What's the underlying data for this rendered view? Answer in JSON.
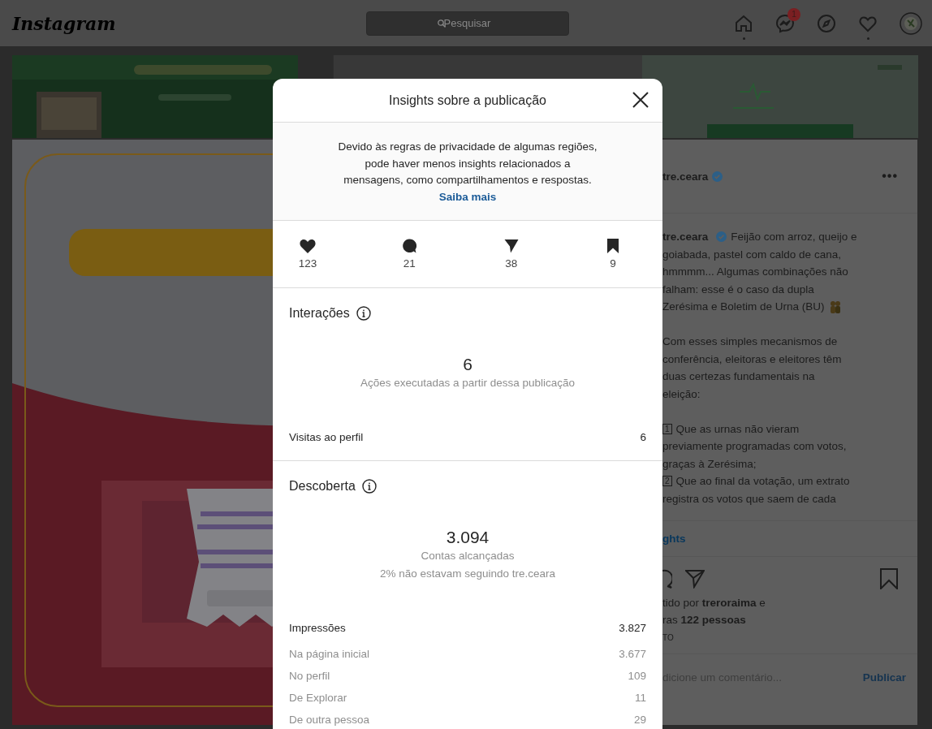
{
  "nav": {
    "logo": "Instagram",
    "search": {
      "placeholder": "Pesquisar"
    },
    "items": [
      {
        "kind": "home",
        "dot": true
      },
      {
        "kind": "messages",
        "badge": "1",
        "dot": false
      },
      {
        "kind": "explore",
        "dot": false
      },
      {
        "kind": "activity",
        "dot": true
      },
      {
        "kind": "profile",
        "dot": false
      }
    ]
  },
  "post": {
    "username": "tre.ceara",
    "verified": true,
    "more": "•••",
    "caption": [
      {
        "kind": "author",
        "user": "tre.ceara",
        "verified": true,
        "text": "Feijão com arroz, queijo e"
      },
      {
        "kind": "text",
        "text": "goiabada, pastel com caldo de cana,"
      },
      {
        "kind": "text",
        "text": "hmmmm... Algumas combinações não"
      },
      {
        "kind": "text",
        "text": "falham: esse é o caso da dupla"
      },
      {
        "kind": "emoji",
        "text": "Zerésima e Boletim de Urna (BU)"
      },
      {
        "kind": "text",
        "text": "Com esses simples mecanismos de",
        "space_before": true
      },
      {
        "kind": "text",
        "text": "conferência, eleitoras e eleitores têm"
      },
      {
        "kind": "text",
        "text": "duas certezas fundamentais na"
      },
      {
        "kind": "text",
        "text": "eleição:"
      },
      {
        "kind": "keycap",
        "keycap": "1",
        "text": "Que as urnas não vieram",
        "space_before": true
      },
      {
        "kind": "text",
        "text": "previamente programadas com votos,"
      },
      {
        "kind": "text",
        "text": "graças à Zerésima;"
      },
      {
        "kind": "keycap",
        "keycap": "2",
        "text": "Que ao final da votação, um extrato"
      },
      {
        "kind": "text",
        "text": "registra os votos que saem de cada"
      }
    ],
    "insights_link": "ghts",
    "liked_by": [
      "tido por **treroraima** e",
      "ras **122 pessoas**"
    ],
    "date": "TO",
    "comment": {
      "placeholder": "dicione um comentário..."
    },
    "publish": "Publicar"
  },
  "insights": {
    "title": "Insights sobre a publicação",
    "notice": {
      "lines": [
        "Devido às regras de privacidade de algumas regiões,",
        "pode haver menos insights relacionados a",
        "mensagens, como compartilhamentos e respostas."
      ],
      "link": "Saiba mais"
    },
    "counts": [
      {
        "kind": "likes",
        "value": "123"
      },
      {
        "kind": "comments",
        "value": "21"
      },
      {
        "kind": "shares",
        "value": "38"
      },
      {
        "kind": "saves",
        "value": "9"
      }
    ],
    "sections": [
      {
        "title": "Interações",
        "total": "6",
        "captions": [
          "Ações executadas a partir dessa publicação"
        ],
        "rows": [
          {
            "kind": "main",
            "label": "Visitas ao perfil",
            "value": "6"
          }
        ]
      },
      {
        "title": "Descoberta",
        "total": "3.094",
        "captions": [
          "Contas alcançadas",
          "2% não estavam seguindo tre.ceara"
        ],
        "rows": [
          {
            "kind": "main",
            "label": "Impressões",
            "value": "3.827"
          },
          {
            "kind": "sub",
            "label": "Na página inicial",
            "value": "3.677"
          },
          {
            "kind": "sub",
            "label": "No perfil",
            "value": "109"
          },
          {
            "kind": "sub",
            "label": "De Explorar",
            "value": "11"
          },
          {
            "kind": "sub",
            "label": "De outra pessoa",
            "value": "29"
          }
        ]
      }
    ]
  }
}
